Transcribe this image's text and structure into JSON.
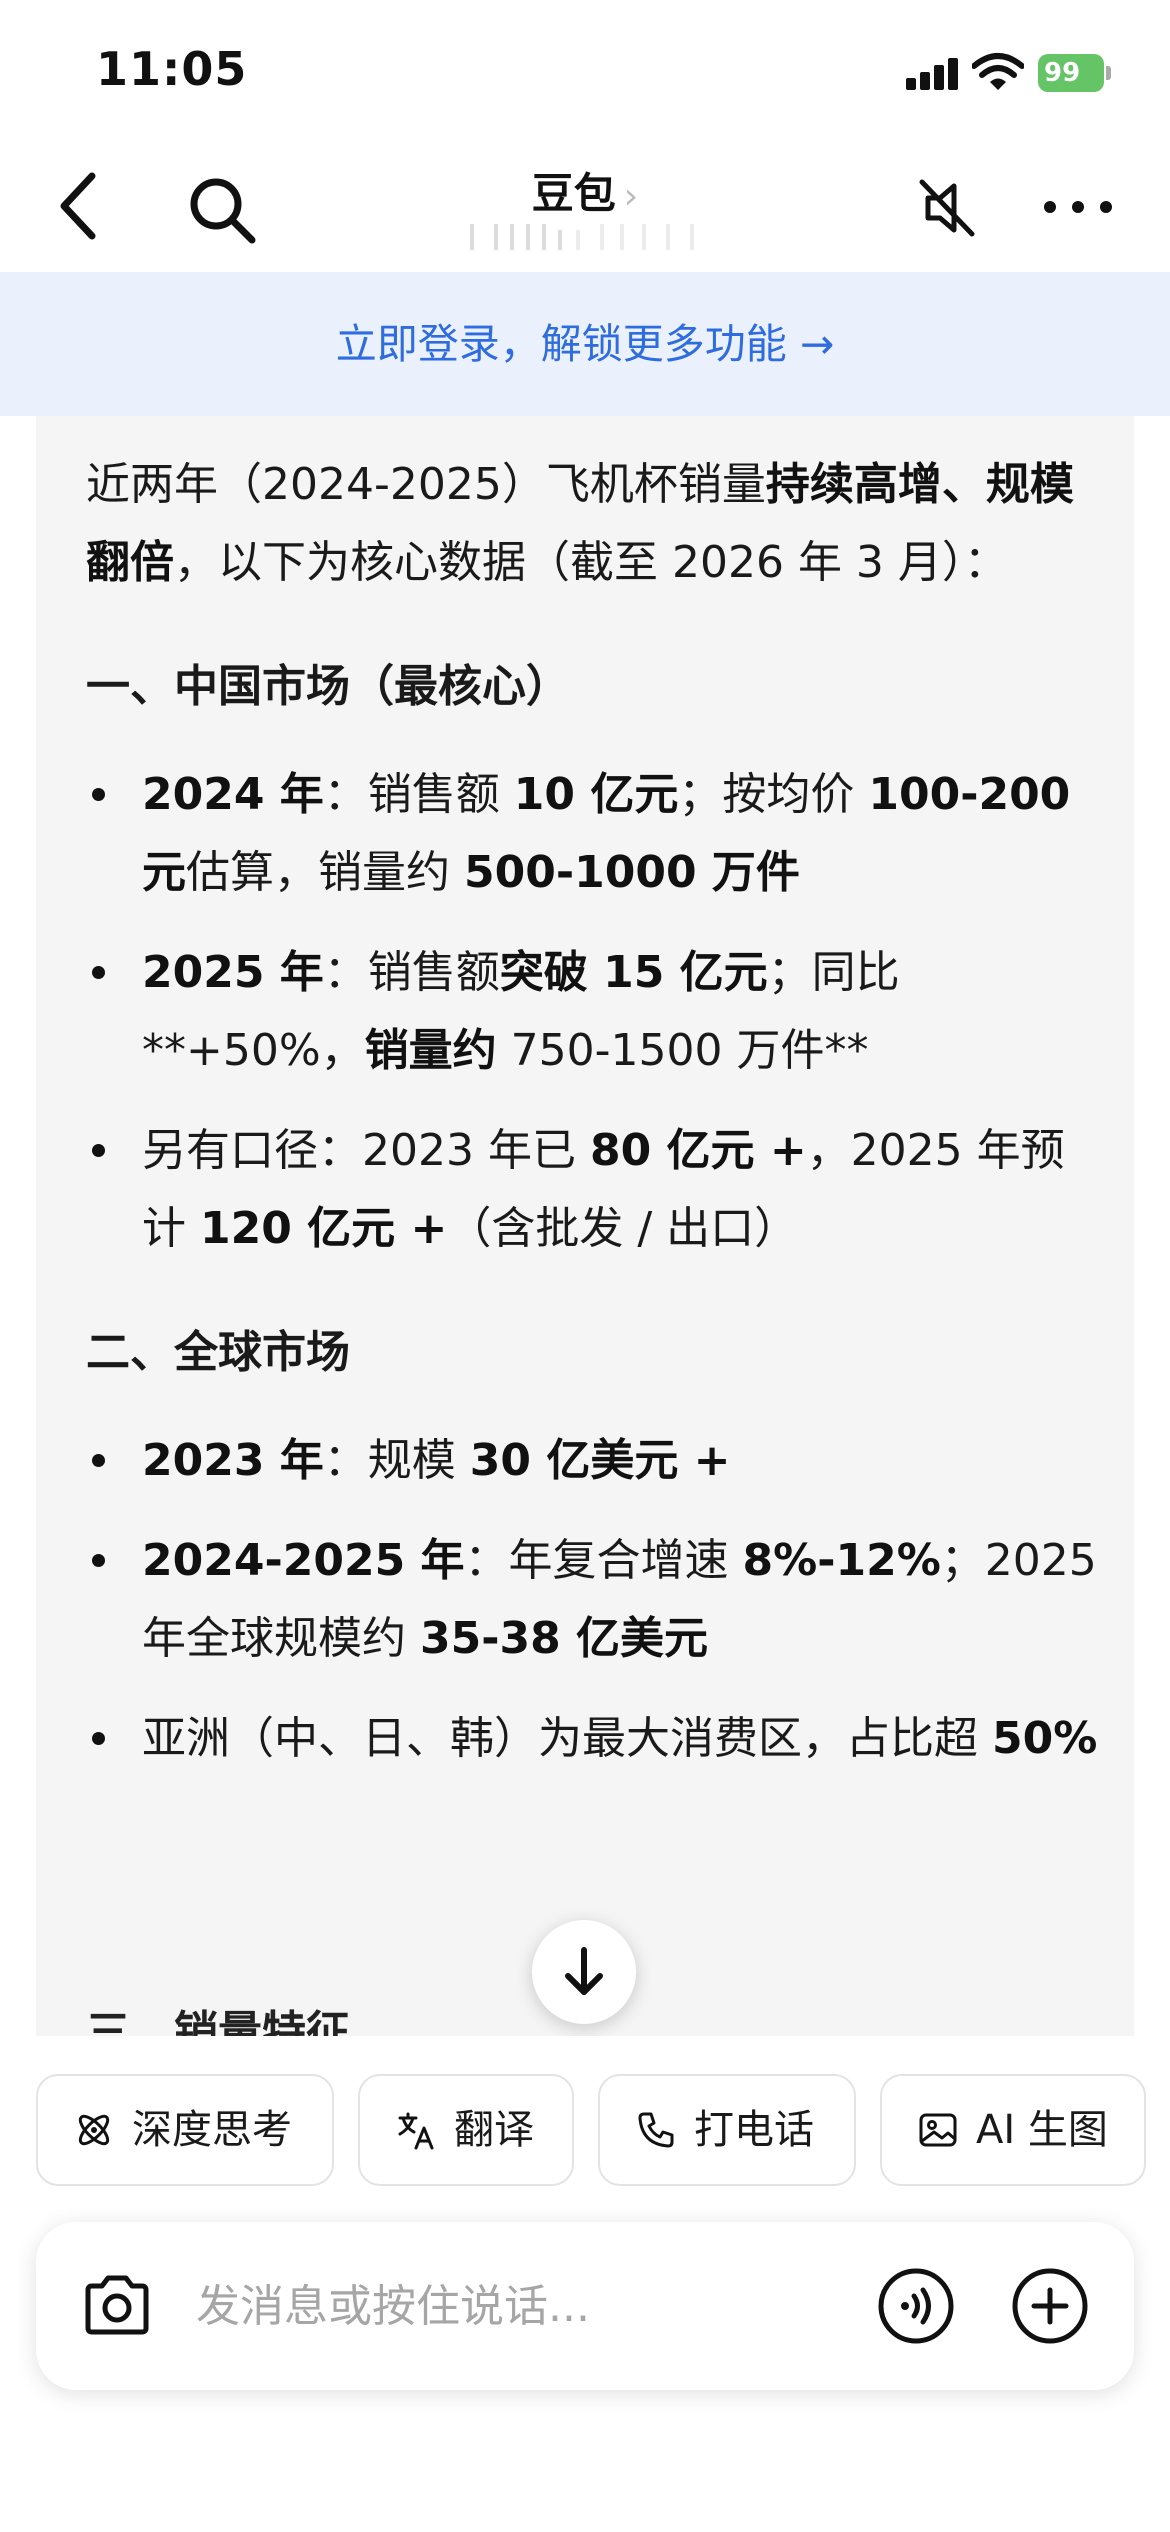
{
  "status_bar": {
    "time": "11:05",
    "battery": "99"
  },
  "nav": {
    "title": "豆包",
    "title_chevron": "›"
  },
  "login_banner": {
    "text": "立即登录，解锁更多功能 →"
  },
  "message": {
    "intro": {
      "a": "近两年（2024-2025）飞机杯销量",
      "b": "持续高增、规模翻倍",
      "c": "，以下为核心数据（截至 2026 年 3 月）："
    },
    "section1": {
      "title": "一、中国市场（最核心）",
      "items": [
        {
          "k": "2024 年",
          "p1": "：销售额 ",
          "b1": "10 亿元",
          "p2": "；按均价 ",
          "b2": "100-200 元",
          "p3": "估算，销量约 ",
          "b3": "500-1000 万件"
        },
        {
          "k": "2025 年",
          "p1": "：销售额",
          "b1": "突破 15 亿元",
          "p2": "；同比 **+50%，",
          "b2": "销量约",
          "p3": " 750-1500 万件**"
        },
        {
          "p0": "另有口径：2023 年已 ",
          "b1": "80 亿元 +",
          "p1": "，2025 年预计 ",
          "b2": "120 亿元 +",
          "p2": "（含批发 / 出口）"
        }
      ]
    },
    "section2": {
      "title": "二、全球市场",
      "items": [
        {
          "k": "2023 年",
          "p1": "：规模 ",
          "b1": "30 亿美元 +"
        },
        {
          "k": "2024-2025 年",
          "p1": "：年复合增速 ",
          "b1": "8%-12%",
          "p2": "；2025 年全球规模约 ",
          "b2": "35-38 亿美元"
        },
        {
          "p0": "亚洲（中、日、韩）为最大消费区，占比超 ",
          "b1": "50%"
        }
      ]
    },
    "section3_partial": "三、销量特征"
  },
  "quick_actions": [
    {
      "label": "深度思考",
      "icon": "atom-icon"
    },
    {
      "label": "翻译",
      "icon": "translate-icon"
    },
    {
      "label": "打电话",
      "icon": "phone-icon"
    },
    {
      "label": "AI 生图",
      "icon": "image-icon"
    }
  ],
  "input": {
    "placeholder": "发消息或按住说话..."
  },
  "colors": {
    "accent": "#2f6cdf",
    "banner_bg": "#eaf1fc",
    "bubble_bg": "#f5f5f6",
    "battery": "#64c466"
  }
}
